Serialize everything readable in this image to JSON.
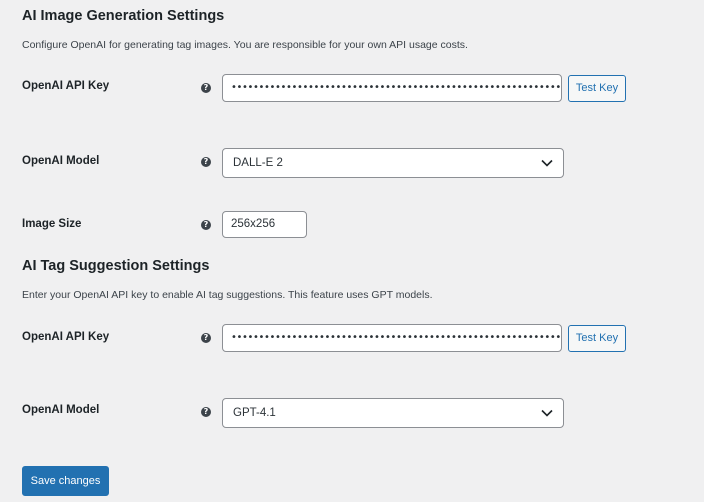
{
  "image_section": {
    "title": "AI Image Generation Settings",
    "description": "Configure OpenAI for generating tag images. You are responsible for your own API usage costs.",
    "api_key_label": "OpenAI API Key",
    "api_key_value": "••••••••••••••••••••••••••••••••••••••••••••••••••••••••••••••••",
    "test_key_label": "Test Key",
    "model_label": "OpenAI Model",
    "model_value": "DALL-E 2",
    "size_label": "Image Size",
    "size_value": "256x256"
  },
  "tag_section": {
    "title": "AI Tag Suggestion Settings",
    "description": "Enter your OpenAI API key to enable AI tag suggestions. This feature uses GPT models.",
    "api_key_label": "OpenAI API Key",
    "api_key_value": "••••••••••••••••••••••••••••••••••••••••••••••••••••••••••••••••",
    "test_key_label": "Test Key",
    "model_label": "OpenAI Model",
    "model_value": "GPT-4.1"
  },
  "help_glyph": "?",
  "save_label": "Save changes",
  "icons": {
    "help": "question-circle-icon",
    "dropdown": "chevron-down-icon"
  },
  "colors": {
    "accent": "#2271b1",
    "background": "#f0f0f1",
    "text": "#1d2327"
  }
}
